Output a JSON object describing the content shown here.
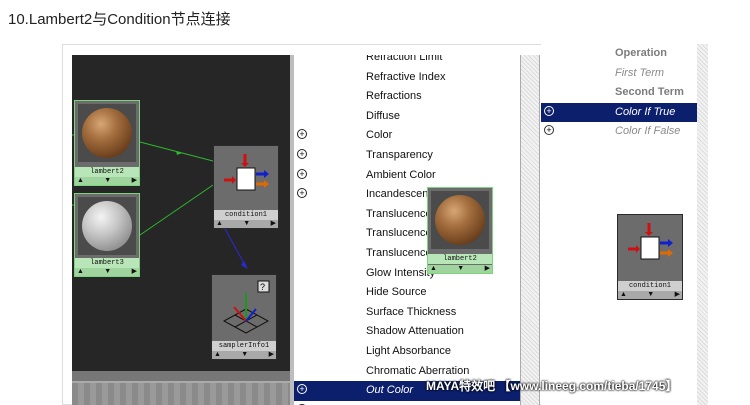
{
  "heading": "10.Lambert2与Condition节点连接",
  "graph": {
    "nodes": {
      "lambert2": "lambert2",
      "lambert3": "lambert3",
      "condition": "condition1",
      "sampler": "samplerInfo1"
    },
    "node_bar": "▲     ▼     ▶",
    "wire_colors": {
      "material": "#2db82d",
      "sampler": "#2a2ad8"
    }
  },
  "attributes": [
    {
      "label": "Refraction Limit",
      "plus": false
    },
    {
      "label": "Refractive Index",
      "plus": false
    },
    {
      "label": "Refractions",
      "plus": false
    },
    {
      "label": "Diffuse",
      "plus": false
    },
    {
      "label": "Color",
      "plus": true
    },
    {
      "label": "Transparency",
      "plus": true
    },
    {
      "label": "Ambient Color",
      "plus": true
    },
    {
      "label": "Incandescence",
      "plus": true
    },
    {
      "label": "Translucence",
      "plus": false
    },
    {
      "label": "Translucence Depth",
      "plus": false
    },
    {
      "label": "Translucence Focus",
      "plus": false
    },
    {
      "label": "Glow Intensity",
      "plus": false
    },
    {
      "label": "Hide Source",
      "plus": false
    },
    {
      "label": "Surface Thickness",
      "plus": false
    },
    {
      "label": "Shadow Attenuation",
      "plus": false
    },
    {
      "label": "Light Absorbance",
      "plus": false
    },
    {
      "label": "Chromatic Aberration",
      "plus": false
    },
    {
      "label": "Out Color",
      "plus": true,
      "selected": true
    },
    {
      "label": "",
      "plus": true
    }
  ],
  "drag_node": "lambert2",
  "right_panel": [
    {
      "label": "Operation",
      "style": "bold"
    },
    {
      "label": "First Term",
      "style": "italic"
    },
    {
      "label": "Second Term",
      "style": "bold"
    },
    {
      "label": "Color If True",
      "style": "selected",
      "plus": true
    },
    {
      "label": "Color If False",
      "style": "italic",
      "plus": true
    }
  ],
  "right_node": "condition1",
  "watermark": "MAYA特效吧 【www.lineeg.com/tieba/1745】",
  "colors": {
    "selection": "#0c1f6d",
    "graph_bg": "#262626"
  }
}
